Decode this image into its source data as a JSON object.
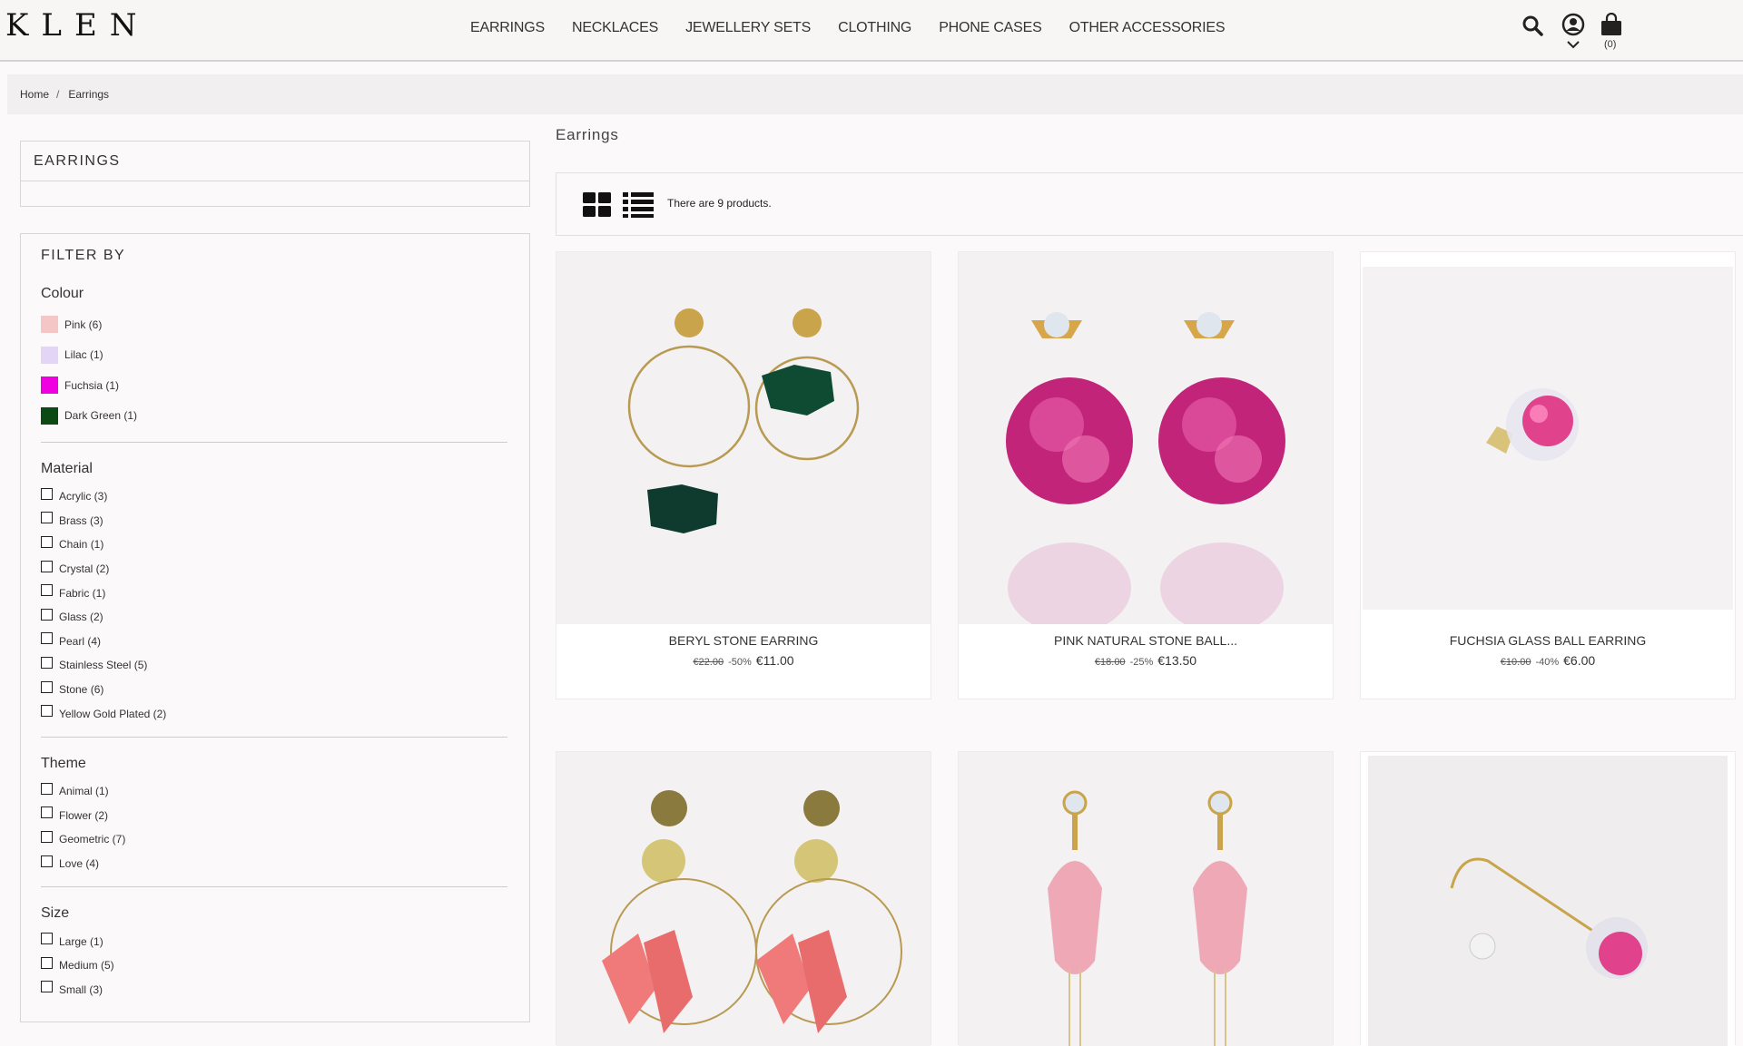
{
  "header": {
    "logo": "KLEN",
    "nav": [
      "EARRINGS",
      "NECKLACES",
      "JEWELLERY SETS",
      "CLOTHING",
      "PHONE CASES",
      "OTHER ACCESSORIES"
    ],
    "cart_count": "(0)"
  },
  "breadcrumb": {
    "home": "Home",
    "sep": "/",
    "current": "Earrings"
  },
  "category_block": {
    "title": "EARRINGS"
  },
  "filters": {
    "title": "FILTER BY",
    "colour_title": "Colour",
    "colours": [
      {
        "label": "Pink (6)",
        "color": "#f5c6c6"
      },
      {
        "label": "Lilac (1)",
        "color": "#e2d5f5"
      },
      {
        "label": "Fuchsia (1)",
        "color": "#f000e0"
      },
      {
        "label": "Dark Green (1)",
        "color": "#0b4a14"
      }
    ],
    "material_title": "Material",
    "materials": [
      "Acrylic (3)",
      "Brass (3)",
      "Chain (1)",
      "Crystal (2)",
      "Fabric (1)",
      "Glass (2)",
      "Pearl (4)",
      "Stainless Steel (5)",
      "Stone (6)",
      "Yellow Gold Plated (2)"
    ],
    "theme_title": "Theme",
    "themes": [
      "Animal (1)",
      "Flower (2)",
      "Geometric (7)",
      "Love (4)"
    ],
    "size_title": "Size",
    "sizes": [
      "Large (1)",
      "Medium (5)",
      "Small (3)"
    ]
  },
  "listing": {
    "heading": "Earrings",
    "count_text": "There are 9 products.",
    "products": [
      {
        "name": "BERYL STONE EARRING",
        "old_price": "€22.00",
        "discount": "-50%",
        "price": "€11.00"
      },
      {
        "name": "PINK NATURAL STONE BALL...",
        "old_price": "€18.00",
        "discount": "-25%",
        "price": "€13.50"
      },
      {
        "name": "FUCHSIA GLASS BALL EARRING",
        "old_price": "€10.00",
        "discount": "-40%",
        "price": "€6.00"
      }
    ]
  }
}
